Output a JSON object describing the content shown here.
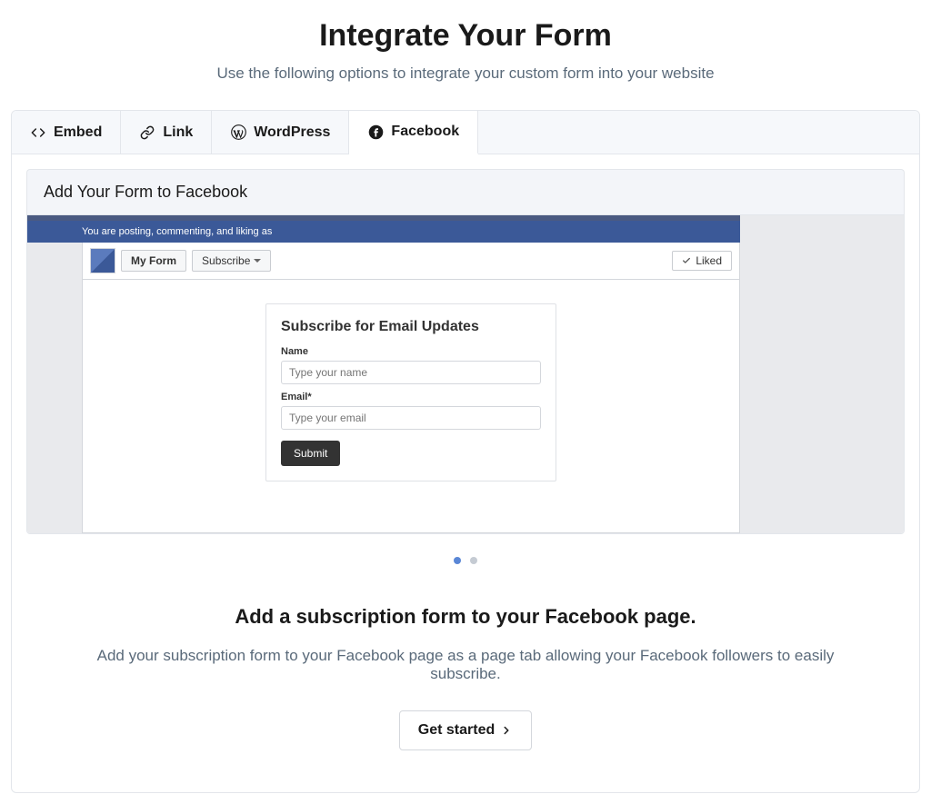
{
  "header": {
    "title": "Integrate Your Form",
    "subtitle": "Use the following options to integrate your custom form into your website"
  },
  "tabs": {
    "items": [
      {
        "label": "Embed"
      },
      {
        "label": "Link"
      },
      {
        "label": "WordPress"
      },
      {
        "label": "Facebook"
      }
    ],
    "active_index": 3
  },
  "panel": {
    "title": "Add Your Form to Facebook"
  },
  "fb_preview": {
    "topbar_text": "You are posting, commenting, and liking as",
    "tab_myform": "My Form",
    "tab_subscribe": "Subscribe",
    "liked_label": "Liked",
    "form": {
      "title": "Subscribe for Email Updates",
      "name_label": "Name",
      "name_placeholder": "Type your name",
      "email_label": "Email*",
      "email_placeholder": "Type your email",
      "submit_label": "Submit"
    }
  },
  "carousel": {
    "count": 2,
    "active_index": 0
  },
  "section": {
    "title": "Add a subscription form to your Facebook page.",
    "description": "Add your subscription form to your Facebook page as a page tab allowing your Facebook followers to easily subscribe.",
    "cta_label": "Get started"
  }
}
